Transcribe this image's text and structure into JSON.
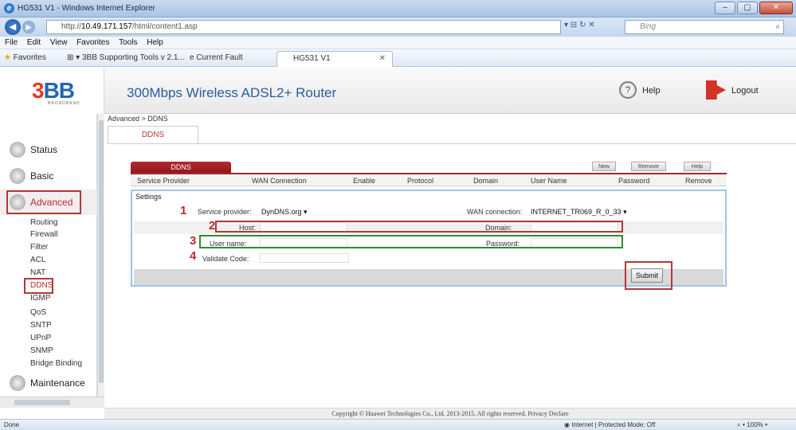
{
  "window": {
    "title": "HG531 V1 - Windows Internet Explorer",
    "controls": [
      "–",
      "▢",
      "✕"
    ]
  },
  "address": {
    "url_prefix": "http://",
    "url_host": "10.49.171.157",
    "url_path": "/html/content1.asp",
    "search_placeholder": "Bing"
  },
  "menu": [
    "File",
    "Edit",
    "View",
    "Favorites",
    "Tools",
    "Help"
  ],
  "favorites": {
    "label": "Favorites",
    "items": [
      "3BB Supporting Tools v 2.1...",
      "Current Fault"
    ],
    "active_tab": "HG531 V1"
  },
  "router": {
    "logo_main": "3",
    "logo_bb": "BB",
    "logo_sub": "BROADBAND",
    "title": "300Mbps Wireless ADSL2+ Router",
    "help": "Help",
    "logout": "Logout"
  },
  "sidebar": {
    "categories": [
      "Status",
      "Basic",
      "Advanced",
      "Maintenance"
    ],
    "sub_items": [
      "Routing",
      "Firewall",
      "Filter",
      "ACL",
      "NAT",
      "DDNS",
      "IGMP",
      "QoS",
      "SNTP",
      "UPnP",
      "SNMP",
      "Bridge Binding"
    ],
    "active_category": "Advanced",
    "active_item": "DDNS"
  },
  "content": {
    "breadcrumb": "Advanced > DDNS",
    "subtab": "DDNS",
    "table_tab": "DDNS",
    "buttons": [
      "New",
      "Remove",
      "Help"
    ],
    "columns": [
      "Service Provider",
      "WAN Connection",
      "Enable",
      "Protocol",
      "Domain",
      "User Name",
      "Password",
      "Remove"
    ],
    "settings": {
      "title": "Settings",
      "service_provider_label": "Service provider:",
      "service_provider_value": "DynDNS.org",
      "wan_connection_label": "WAN connection:",
      "wan_connection_value": "INTERNET_TR069_R_0_33",
      "host_label": "Host:",
      "domain_label": "Domain:",
      "user_label": "User name:",
      "password_label": "Password:",
      "validate_label": "Validate Code:",
      "submit": "Submit"
    },
    "step_numbers": [
      "1",
      "2",
      "3",
      "4"
    ]
  },
  "footer": {
    "copyright": "Copyright © Huawei Technologies Co., Ltd. 2013-2015. All rights reserved. Privacy Declare",
    "status_left": "Done",
    "status_zone": "Internet | Protected Mode: Off",
    "zoom": "100%"
  }
}
